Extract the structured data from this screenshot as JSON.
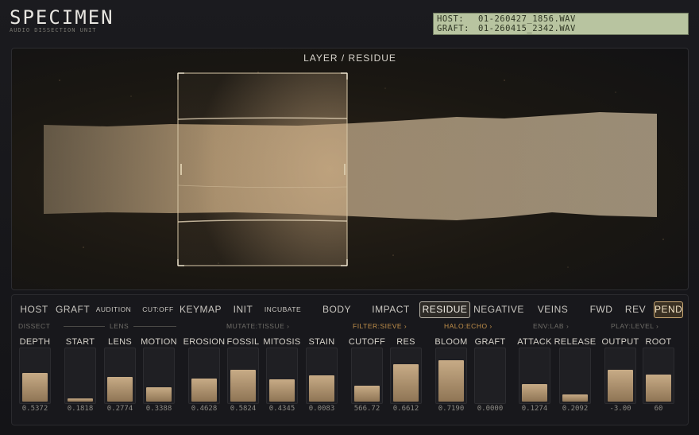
{
  "header": {
    "title": "SPECIMEN",
    "subtitle": "AUDIO DISSECTION UNIT"
  },
  "file_display": {
    "host_key": "HOST:",
    "host_file": "01-260427_1856.WAV",
    "graft_key": "GRAFT:",
    "graft_file": "01-260415_2342.WAV"
  },
  "viewport": {
    "title": "LAYER / RESIDUE"
  },
  "toolbar": {
    "host": "HOST",
    "graft": "GRAFT",
    "audition": "AUDITION",
    "cutoff": "CUT:OFF",
    "keymap": "KEYMAP",
    "init": "INIT",
    "incubate": "INCUBATE",
    "body": "BODY",
    "impact": "IMPACT",
    "residue": "RESIDUE",
    "negative": "NEGATIVE",
    "veins": "VEINS",
    "fwd": "FWD",
    "rev": "REV",
    "pend": "PEND"
  },
  "sections": {
    "dissect": "DISSECT",
    "lens": "LENS",
    "mutate": "MUTATE:TISSUE  ›",
    "filter": "FILTER:SIEVE  ›",
    "halo": "HALO:ECHO  ›",
    "env": "ENV:LAB  ›",
    "play": "PLAY:LEVEL  ›"
  },
  "params": [
    {
      "label": "DEPTH",
      "value": "0.5372",
      "level": 0.54
    },
    {
      "label": "START",
      "value": "0.1818",
      "level": 0.06
    },
    {
      "label": "LENS",
      "value": "0.2774",
      "level": 0.47
    },
    {
      "label": "MOTION",
      "value": "0.3388",
      "level": 0.27
    },
    {
      "label": "EROSION",
      "value": "0.4628",
      "level": 0.44
    },
    {
      "label": "FOSSIL",
      "value": "0.5824",
      "level": 0.6
    },
    {
      "label": "MITOSIS",
      "value": "0.4345",
      "level": 0.43
    },
    {
      "label": "STAIN",
      "value": "0.0083",
      "level": 0.5
    },
    {
      "label": "CUTOFF",
      "value": "566.72",
      "level": 0.3
    },
    {
      "label": "RES",
      "value": "0.6612",
      "level": 0.71
    },
    {
      "label": "BLOOM",
      "value": "0.7190",
      "level": 0.79
    },
    {
      "label": "GRAFT",
      "value": "0.0000",
      "level": 0.0
    },
    {
      "label": "ATTACK",
      "value": "0.1274",
      "level": 0.33
    },
    {
      "label": "RELEASE",
      "value": "0.2092",
      "level": 0.13
    },
    {
      "label": "OUTPUT",
      "value": "-3.00",
      "level": 0.61
    },
    {
      "label": "ROOT",
      "value": "60",
      "level": 0.51
    }
  ],
  "colors": {
    "accent": "#c7ab86",
    "amber": "#c2904a",
    "lcd": "#b8c4a0"
  }
}
